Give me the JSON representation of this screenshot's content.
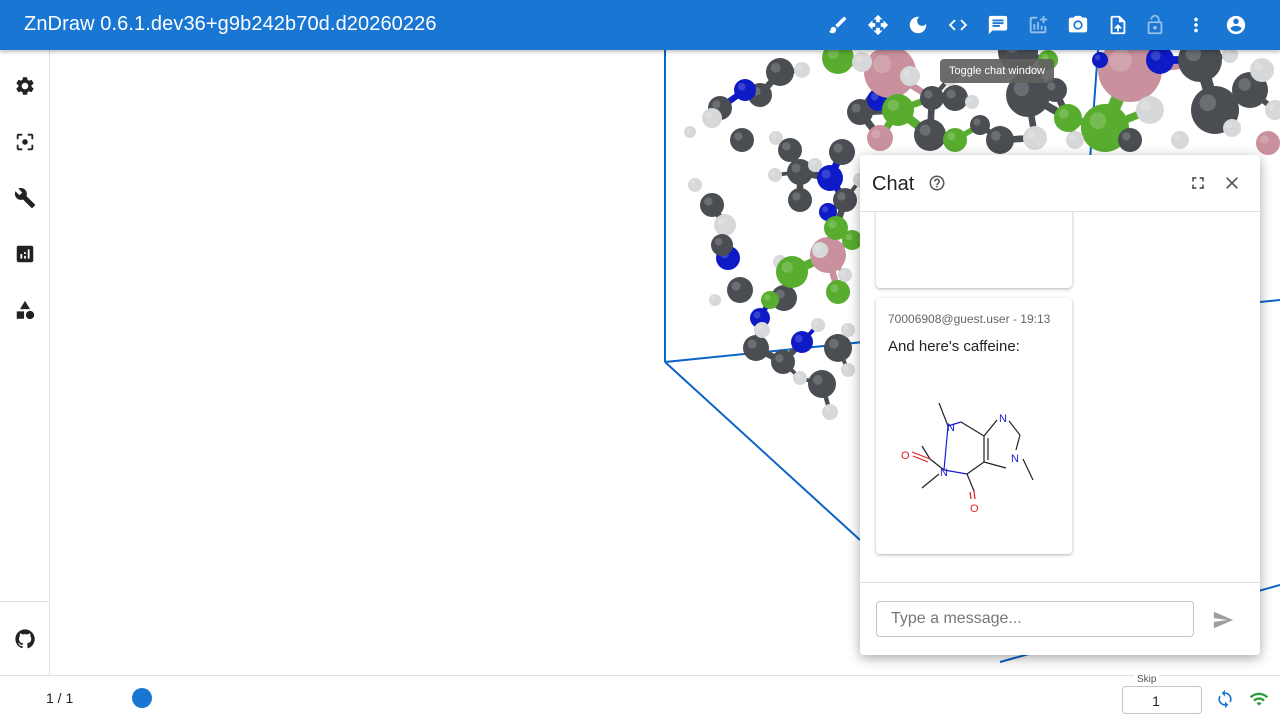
{
  "app": {
    "title": "ZnDraw 0.6.1.dev36+g9b242b70d.d20260226",
    "accent_color": "#1976d2"
  },
  "toolbar": {
    "buttons": [
      {
        "icon": "brush-icon"
      },
      {
        "icon": "move-arrows-icon"
      },
      {
        "icon": "dark-mode-icon"
      },
      {
        "icon": "code-icon"
      },
      {
        "icon": "chat-icon"
      },
      {
        "icon": "add-chart-icon"
      },
      {
        "icon": "camera-icon"
      },
      {
        "icon": "upload-file-icon"
      },
      {
        "icon": "lock-open-icon"
      },
      {
        "icon": "more-vert-icon"
      },
      {
        "icon": "account-circle-icon"
      }
    ],
    "tooltip": "Toggle chat window"
  },
  "sidebar": {
    "items": [
      {
        "icon": "gear-icon"
      },
      {
        "icon": "center-focus-icon"
      },
      {
        "icon": "wrench-icon"
      },
      {
        "icon": "analytics-icon"
      },
      {
        "icon": "shapes-icon"
      }
    ],
    "footer_icon": "github-icon"
  },
  "chat": {
    "title": "Chat",
    "messages": [
      {
        "meta": "",
        "text": ""
      },
      {
        "meta": "70006908@guest.user - 19:13",
        "text": "And here's caffeine:",
        "image": "caffeine-structure"
      }
    ],
    "molecule_labels": {
      "n1": "N",
      "n2": "N",
      "n3": "N",
      "n4": "N",
      "o1": "O",
      "o2": "O"
    },
    "input_placeholder": "Type a message..."
  },
  "bottom": {
    "frame_counter": "1 / 1",
    "skip_label": "Skip",
    "skip_value": "1",
    "progress_fraction": 0.0
  },
  "colors": {
    "carbon": "#4a4d52",
    "hydrogen": "#d6d8da",
    "nitrogen": "#0d1ac6",
    "fluorine": "#58ad2e",
    "boron": "#c9919d",
    "cell": "#0a63c9"
  }
}
